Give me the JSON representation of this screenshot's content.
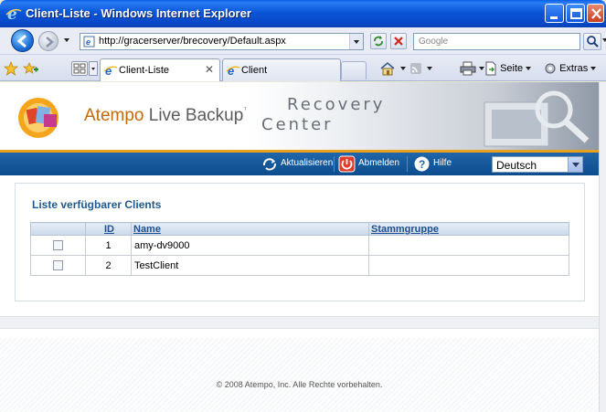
{
  "window": {
    "title": "Client-Liste - Windows Internet Explorer"
  },
  "address_bar": {
    "url": "http://gracerserver/brecovery/Default.aspx",
    "search_placeholder": "Google"
  },
  "tabs": [
    {
      "label": "Client-Liste",
      "active": true
    },
    {
      "label": "Client",
      "active": false
    }
  ],
  "command_bar": {
    "page_label": "Seite",
    "extras_label": "Extras"
  },
  "header": {
    "brand_part1": "Atempo",
    "brand_part2": " Live Backup",
    "brand_tm": "™",
    "product_line1": "Recovery",
    "product_line2": "Center"
  },
  "navbar": {
    "refresh_label": "Aktualisieren",
    "logout_label": "Abmelden",
    "help_label": "Hilfe",
    "language": "Deutsch"
  },
  "client_list": {
    "title": "Liste verfügbarer Clients",
    "columns": [
      "",
      "ID",
      "Name",
      "Stammgruppe"
    ],
    "rows": [
      {
        "id": "1",
        "name": "amy-dv9000",
        "group": ""
      },
      {
        "id": "2",
        "name": "TestClient",
        "group": ""
      }
    ]
  },
  "footer": {
    "copyright": "© 2008 Atempo, Inc. Alle Rechte vorbehalten."
  },
  "colors": {
    "accent_orange": "#e9a11d",
    "navbar_blue": "#1f66a8",
    "title_blue": "#1f5b91"
  }
}
